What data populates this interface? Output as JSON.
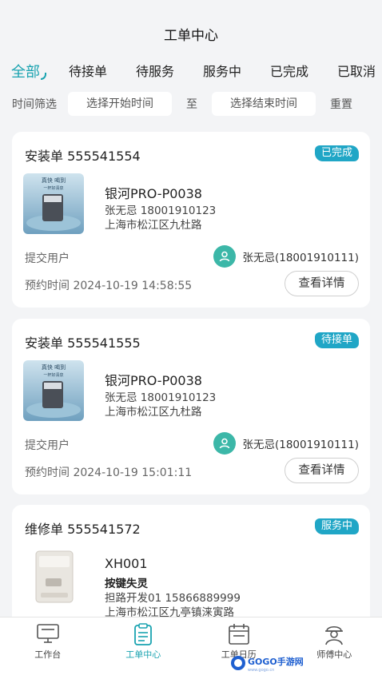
{
  "header": {
    "title": "工单中心"
  },
  "tabs": [
    {
      "label": "全部"
    },
    {
      "label": "待接单"
    },
    {
      "label": "待服务"
    },
    {
      "label": "服务中"
    },
    {
      "label": "已完成"
    },
    {
      "label": "已取消"
    }
  ],
  "filter": {
    "label": "时间筛选",
    "start_placeholder": "选择开始时间",
    "separator": "至",
    "end_placeholder": "选择结束时间",
    "reset_label": "重置"
  },
  "orders": [
    {
      "type_label": "安装单 555541554",
      "status": "已完成",
      "product_name": "银河PRO-P0038",
      "contact": "张无忌 18001910123",
      "address": "上海市松江区九杜路",
      "submit_label": "提交用户",
      "submit_user": "张无忌(18001910111)",
      "appointment": "预约时间  2024-10-19 14:58:55",
      "detail_label": "查看详情",
      "image_text": "真快 喝到\n一杯好清泉"
    },
    {
      "type_label": "安装单 555541555",
      "status": "待接单",
      "product_name": "银河PRO-P0038",
      "contact": "张无忌 18001910123",
      "address": "上海市松江区九杜路",
      "submit_label": "提交用户",
      "submit_user": "张无忌(18001910111)",
      "appointment": "预约时间  2024-10-19 15:01:11",
      "detail_label": "查看详情",
      "image_text": "真快 喝到\n一杯好清泉"
    },
    {
      "type_label": "维修单 555541572",
      "status": "服务中",
      "product_name": "XH001",
      "fault": "按键失灵",
      "contact": "担路开发01 15866889999",
      "address": "上海市松江区九亭镇涞寅路"
    }
  ],
  "nav": [
    {
      "label": "工作台",
      "icon": "monitor-icon"
    },
    {
      "label": "工单中心",
      "icon": "clipboard-icon"
    },
    {
      "label": "工单日历",
      "icon": "calendar-icon"
    },
    {
      "label": "师傅中心",
      "icon": "worker-icon"
    }
  ],
  "watermark": {
    "text": "GOGO手游网",
    "sub": "www.gogo.cn"
  },
  "colors": {
    "accent": "#1aa3b0",
    "badge": "#20a6c6",
    "avatar": "#3cb7a8"
  }
}
